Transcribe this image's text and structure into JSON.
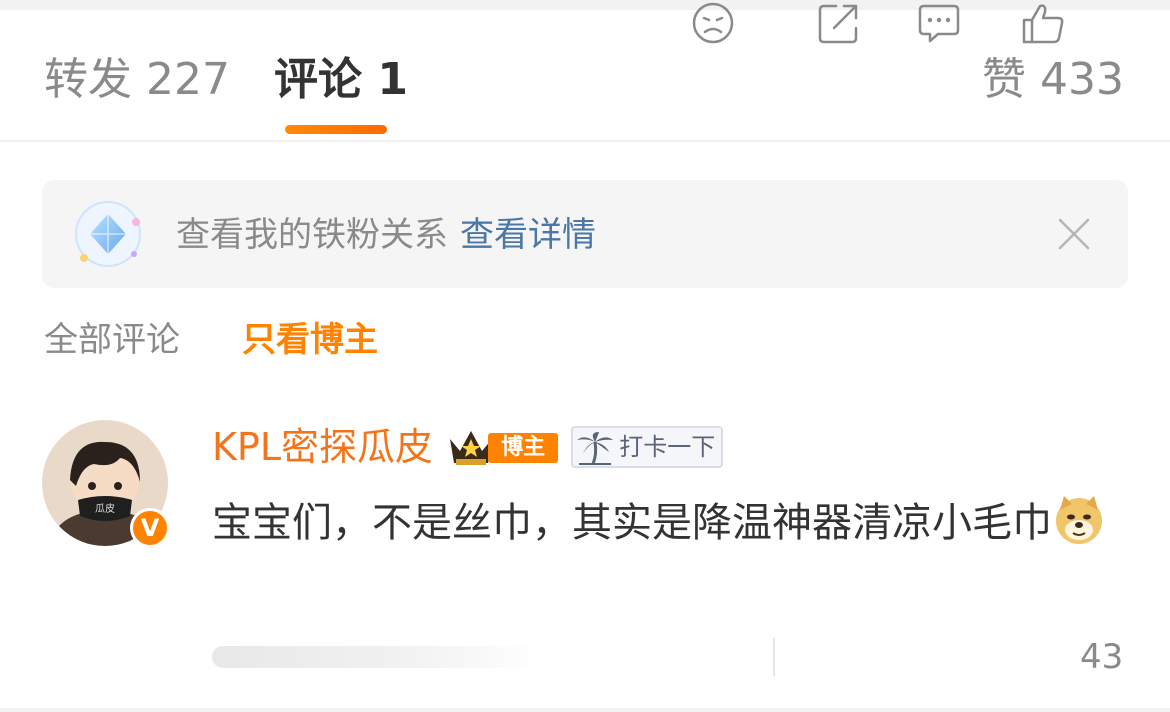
{
  "tabs": {
    "repost": "转发 227",
    "comment": "评论 1",
    "like": "赞 433"
  },
  "banner": {
    "text": "查看我的铁粉关系",
    "link": "查看详情"
  },
  "filter": {
    "all": "全部评论",
    "blogger_only": "只看博主"
  },
  "comment": {
    "username": "KPL密探瓜皮",
    "verified_badge": "V",
    "blogger_tag": "博主",
    "checkin_tag": "打卡一下",
    "text": "宝宝们，不是丝巾，其实是降温神器清凉小毛巾",
    "emoji": "doge-icon",
    "like_count": "43"
  },
  "colors": {
    "accent": "#ff8200",
    "username": "#f4741b",
    "link": "#4a76a8"
  }
}
